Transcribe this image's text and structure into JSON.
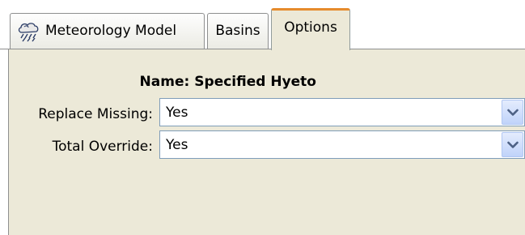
{
  "tabs": [
    {
      "label": "Meteorology Model",
      "icon": "meteorology-icon",
      "selected": false
    },
    {
      "label": "Basins",
      "selected": false
    },
    {
      "label": "Options",
      "selected": true
    }
  ],
  "options": {
    "name_label": "Name:",
    "name_value": "Specified Hyeto",
    "replace_missing": {
      "label": "Replace Missing:",
      "value": "Yes"
    },
    "total_override": {
      "label": "Total Override:",
      "value": "Yes"
    }
  },
  "colors": {
    "panel_background": "#ece9d8",
    "selected_tab_accent": "#e68b2c",
    "combo_border": "#7f9db9",
    "combo_button": "#c0d3fa",
    "arrow": "#4d6185"
  }
}
